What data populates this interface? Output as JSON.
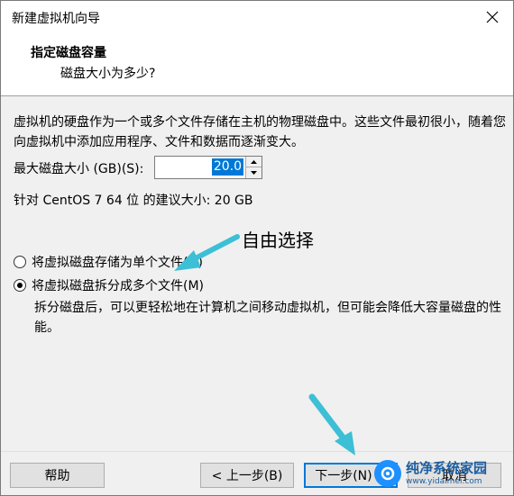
{
  "window": {
    "title": "新建虚拟机向导"
  },
  "header": {
    "title": "指定磁盘容量",
    "subtitle": "磁盘大小为多少?"
  },
  "body": {
    "description": "虚拟机的硬盘作为一个或多个文件存储在主机的物理磁盘中。这些文件最初很小，随着您向虚拟机中添加应用程序、文件和数据而逐渐变大。",
    "max_size_label": "最大磁盘大小 (GB)(S):",
    "max_size_value": "20.0",
    "recommended": "针对 CentOS 7 64 位 的建议大小: 20 GB",
    "options": [
      {
        "label": "将虚拟磁盘存储为单个文件(O)",
        "checked": false
      },
      {
        "label": "将虚拟磁盘拆分成多个文件(M)",
        "checked": true
      }
    ],
    "split_help": "拆分磁盘后，可以更轻松地在计算机之间移动虚拟机，但可能会降低大容量磁盘的性能。"
  },
  "annotation": {
    "text": "自由选择",
    "color": "#3dbfd6"
  },
  "footer": {
    "help": "帮助",
    "back": "< 上一步(B)",
    "next": "下一步(N) >",
    "cancel": "取消"
  },
  "watermark": {
    "name": "纯净系统家园",
    "url": "www.yidaimei.com"
  },
  "colors": {
    "selection": "#0078d7",
    "arrow": "#3dbfd6"
  }
}
